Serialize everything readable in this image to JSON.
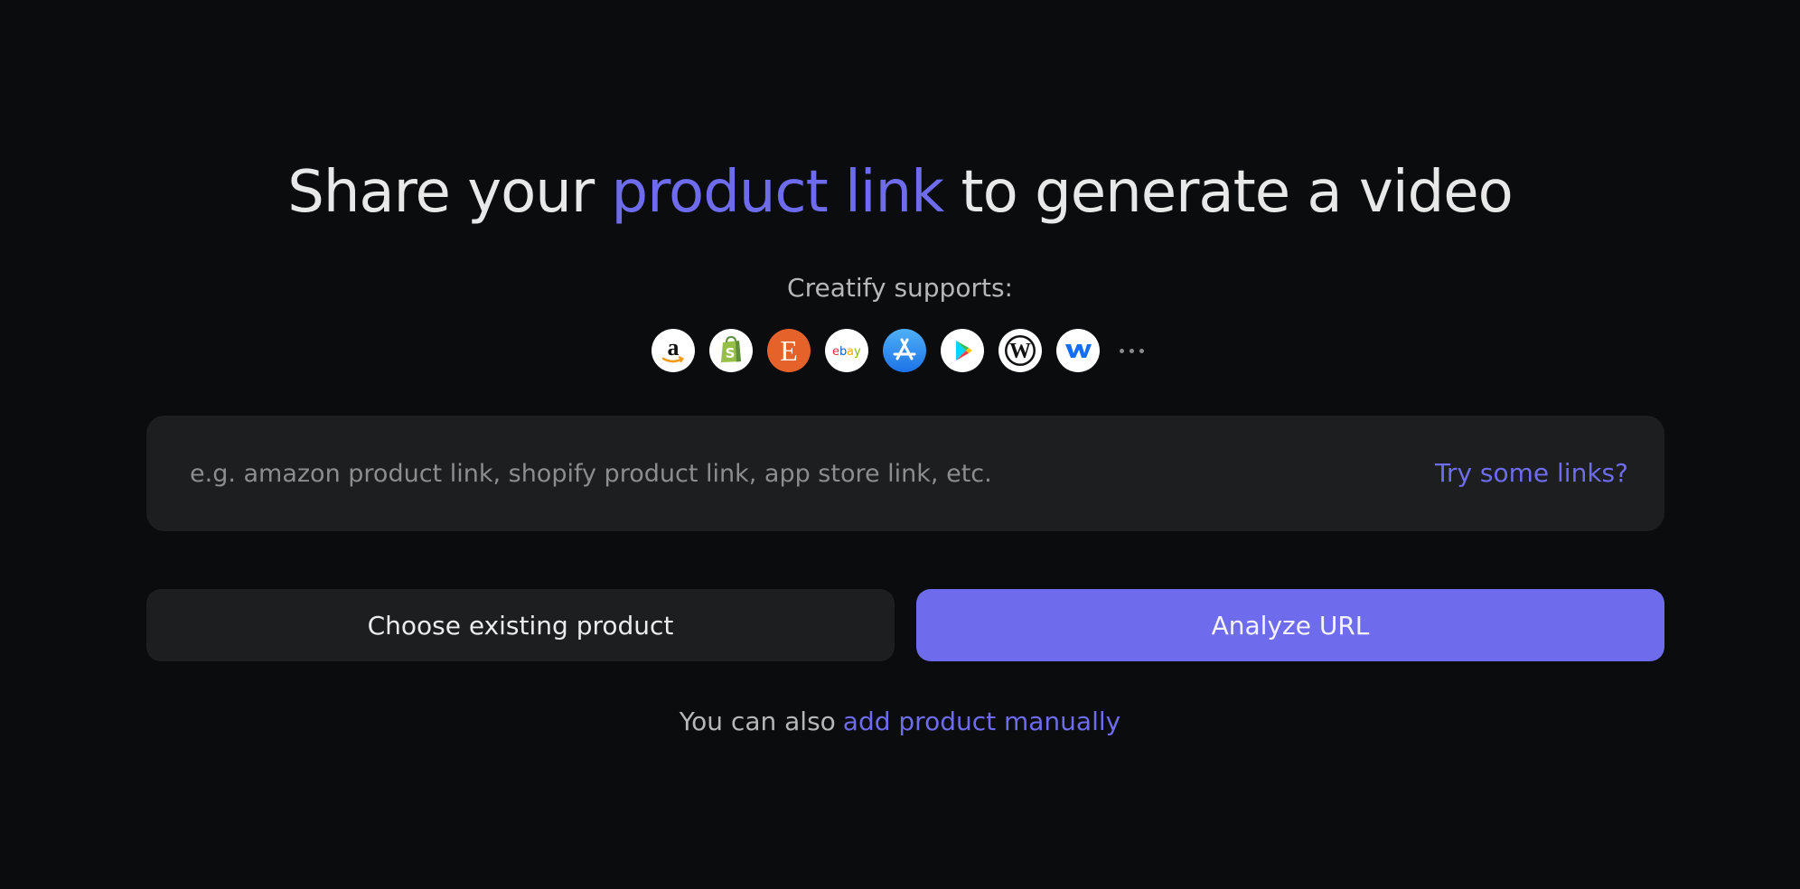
{
  "headline": {
    "before": "Share your ",
    "accent": "product link",
    "after": " to generate a video"
  },
  "supports_label": "Creatify supports:",
  "platforms": [
    {
      "name": "Amazon",
      "icon": "amazon-icon"
    },
    {
      "name": "Shopify",
      "icon": "shopify-icon"
    },
    {
      "name": "Etsy",
      "icon": "etsy-icon"
    },
    {
      "name": "eBay",
      "icon": "ebay-icon"
    },
    {
      "name": "App Store",
      "icon": "app-store-icon"
    },
    {
      "name": "Google Play",
      "icon": "google-play-icon"
    },
    {
      "name": "WordPress",
      "icon": "wordpress-icon"
    },
    {
      "name": "Webflow",
      "icon": "webflow-icon"
    }
  ],
  "more_icon": "more-dots-icon",
  "url_input": {
    "value": "",
    "placeholder": "e.g. amazon product link, shopify product link, app store link, etc."
  },
  "try_links_label": "Try some links?",
  "buttons": {
    "choose_existing": "Choose existing product",
    "analyze": "Analyze URL"
  },
  "footer": {
    "text": "You can also",
    "link": "add product manually"
  },
  "colors": {
    "background": "#0a0c0d",
    "accent": "#6e6cec",
    "surface": "#1c1e1f",
    "text": "#e8e8e8",
    "muted": "#b7b7b7"
  }
}
